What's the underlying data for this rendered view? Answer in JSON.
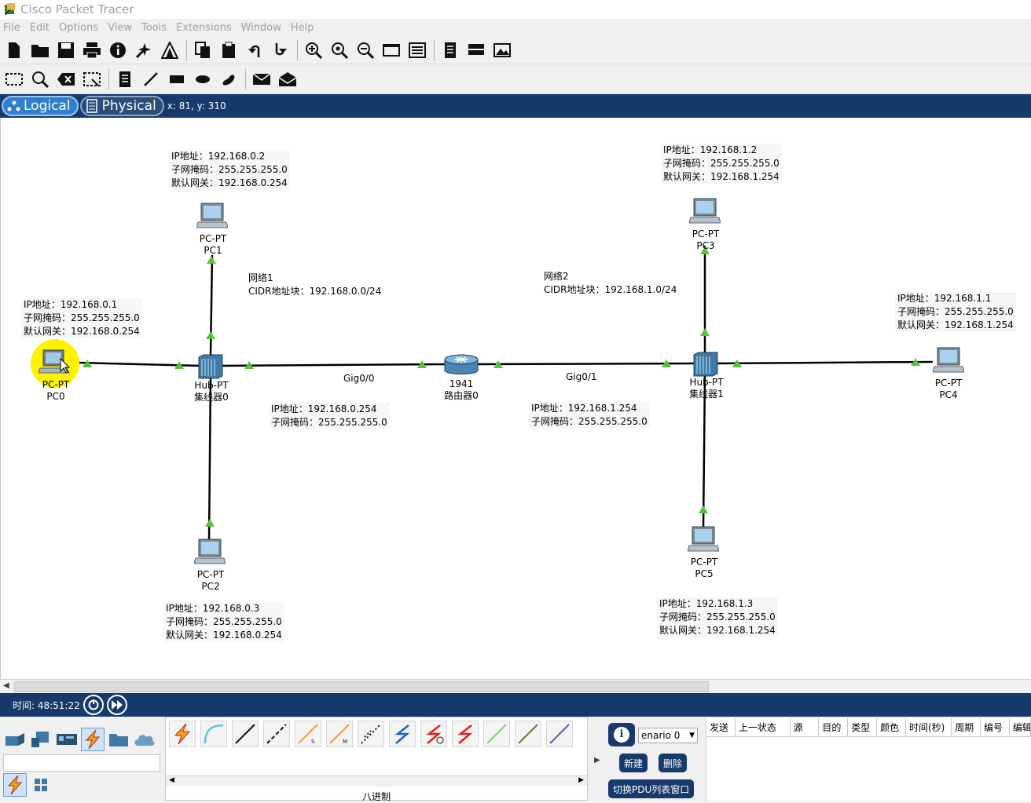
{
  "window": {
    "title": "Cisco Packet Tracer"
  },
  "menu": [
    "File",
    "Edit",
    "Options",
    "View",
    "Tools",
    "Extensions",
    "Window",
    "Help"
  ],
  "modebar": {
    "logical": "Logical",
    "physical": "Physical",
    "coords": "x: 81, y: 310"
  },
  "devices": {
    "pc0": {
      "type": "PC-PT",
      "name": "PC0"
    },
    "pc1": {
      "type": "PC-PT",
      "name": "PC1"
    },
    "pc2": {
      "type": "PC-PT",
      "name": "PC2"
    },
    "pc3": {
      "type": "PC-PT",
      "name": "PC3"
    },
    "pc4": {
      "type": "PC-PT",
      "name": "PC4"
    },
    "pc5": {
      "type": "PC-PT",
      "name": "PC5"
    },
    "hub0": {
      "type": "Hub-PT",
      "name": "集线器0"
    },
    "hub1": {
      "type": "Hub-PT",
      "name": "集线器1"
    },
    "router0": {
      "type": "1941",
      "name": "路由器0"
    }
  },
  "ports": {
    "gig00": "Gig0/0",
    "gig01": "Gig0/1"
  },
  "notes": {
    "pc1": {
      "ip": "IP地址：192.168.0.2",
      "mask": "子网掩码：255.255.255.0",
      "gw": "默认网关：192.168.0.254"
    },
    "pc0": {
      "ip": "IP地址：192.168.0.1",
      "mask": "子网掩码：255.255.255.0",
      "gw": "默认网关：192.168.0.254"
    },
    "pc2": {
      "ip": "IP地址：192.168.0.3",
      "mask": "子网掩码：255.255.255.0",
      "gw": "默认网关：192.168.0.254"
    },
    "pc3": {
      "ip": "IP地址：192.168.1.2",
      "mask": "子网掩码：255.255.255.0",
      "gw": "默认网关：192.168.1.254"
    },
    "pc4": {
      "ip": "IP地址：192.168.1.1",
      "mask": "子网掩码：255.255.255.0",
      "gw": "默认网关：192.168.1.254"
    },
    "pc5": {
      "ip": "IP地址：192.168.1.3",
      "mask": "子网掩码：255.255.255.0",
      "gw": "默认网关：192.168.1.254"
    },
    "net1": {
      "name": "网络1",
      "cidr": "CIDR地址块：192.168.0.0/24"
    },
    "net2": {
      "name": "网络2",
      "cidr": "CIDR地址块：192.168.1.0/24"
    },
    "gig00": {
      "ip": "IP地址：192.168.0.254",
      "mask": "子网掩码：255.255.255.0"
    },
    "gig01": {
      "ip": "IP地址：192.168.1.254",
      "mask": "子网掩码：255.255.255.0"
    }
  },
  "timebar": {
    "time": "时间: 48:51:22"
  },
  "bottom": {
    "conn_caption": "八进制",
    "scenario": "enario 0",
    "new_btn": "新建",
    "delete_btn": "删除",
    "toggle_btn": "切换PDU列表窗口",
    "pdu_columns": [
      "发送",
      "上一状态",
      "源",
      "目的",
      "类型",
      "颜色",
      "时间(秒)",
      "周期",
      "编号",
      "编辑"
    ]
  },
  "colors": {
    "mode_bar": "#163a6b",
    "link": "#000000",
    "link_up": "#5bbf3a",
    "cursor_glow": "#fff200"
  }
}
